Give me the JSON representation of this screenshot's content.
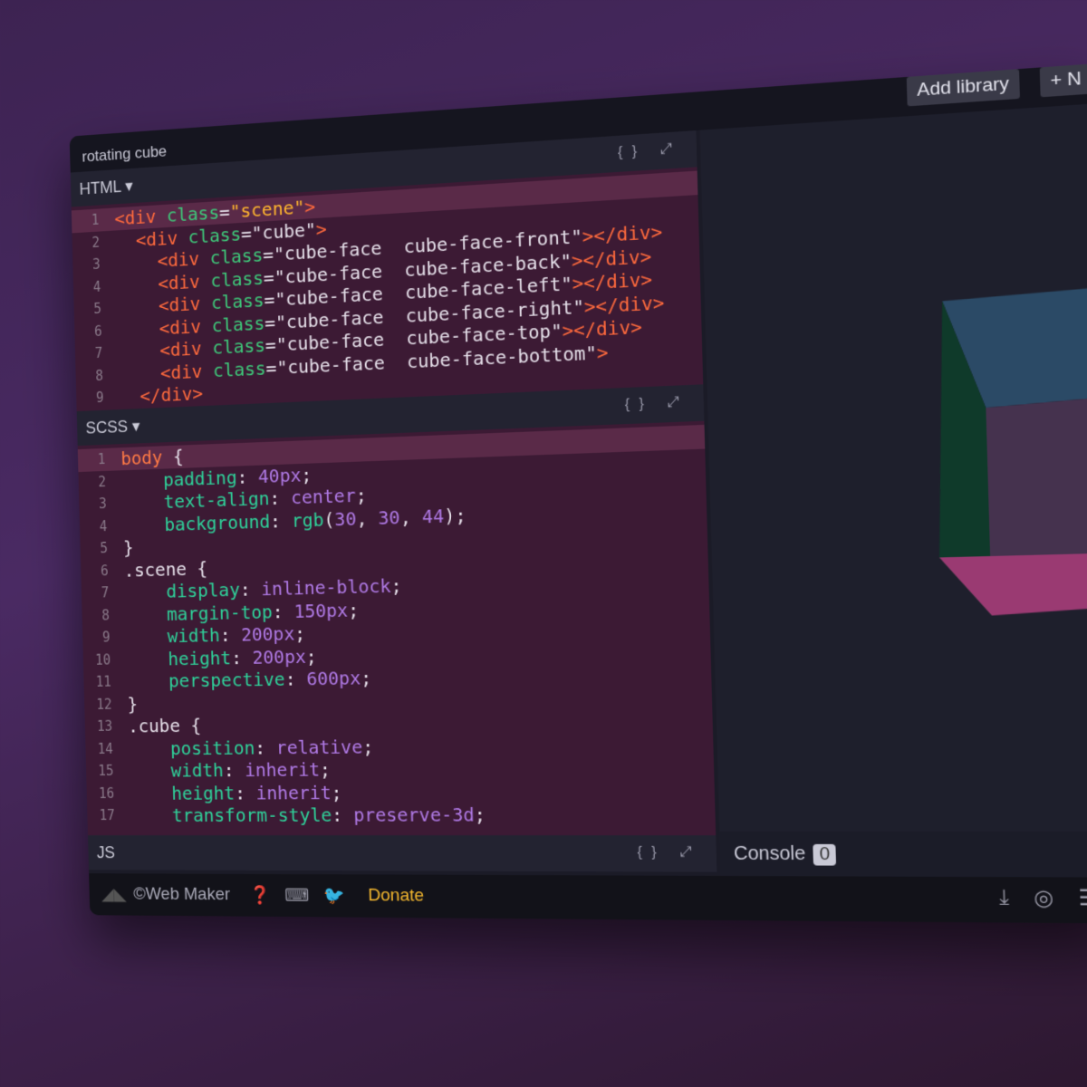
{
  "window": {
    "title": "rotating cube",
    "add_library": "Add library",
    "new": "+ N"
  },
  "html_pane": {
    "label": "HTML ▾",
    "icons": "{} ⤢",
    "lines": [
      [
        [
          "<div ",
          "tag"
        ],
        [
          "class",
          "attr"
        ],
        [
          "=",
          "plain"
        ],
        [
          "\"scene\"",
          "str"
        ],
        [
          ">",
          "tag"
        ]
      ],
      [
        [
          "  <div ",
          "tag"
        ],
        [
          "class",
          "attr"
        ],
        [
          "=\"cube\"",
          "plain"
        ],
        [
          ">",
          "tag"
        ]
      ],
      [
        [
          "    <div ",
          "tag"
        ],
        [
          "class",
          "attr"
        ],
        [
          "=\"cube-face  cube-face-front\"",
          "plain"
        ],
        [
          "></div>",
          "tag"
        ]
      ],
      [
        [
          "    <div ",
          "tag"
        ],
        [
          "class",
          "attr"
        ],
        [
          "=\"cube-face  cube-face-back\"",
          "plain"
        ],
        [
          "></div>",
          "tag"
        ]
      ],
      [
        [
          "    <div ",
          "tag"
        ],
        [
          "class",
          "attr"
        ],
        [
          "=\"cube-face  cube-face-left\"",
          "plain"
        ],
        [
          "></div>",
          "tag"
        ]
      ],
      [
        [
          "    <div ",
          "tag"
        ],
        [
          "class",
          "attr"
        ],
        [
          "=\"cube-face  cube-face-right\"",
          "plain"
        ],
        [
          "></div>",
          "tag"
        ]
      ],
      [
        [
          "    <div ",
          "tag"
        ],
        [
          "class",
          "attr"
        ],
        [
          "=\"cube-face  cube-face-top\"",
          "plain"
        ],
        [
          "></div>",
          "tag"
        ]
      ],
      [
        [
          "    <div ",
          "tag"
        ],
        [
          "class",
          "attr"
        ],
        [
          "=\"cube-face  cube-face-bottom\"",
          "plain"
        ],
        [
          ">",
          "tag"
        ]
      ],
      [
        [
          "  </div>",
          "tag"
        ]
      ]
    ]
  },
  "scss_pane": {
    "label": "SCSS ▾",
    "icons": "{} ⤢",
    "lines": [
      [
        [
          "body ",
          "sel"
        ],
        [
          "{",
          "plain"
        ]
      ],
      [
        [
          "    padding",
          "prop"
        ],
        [
          ": ",
          "plain"
        ],
        [
          "40px",
          "val"
        ],
        [
          ";",
          "plain"
        ]
      ],
      [
        [
          "    text-align",
          "prop"
        ],
        [
          ": ",
          "plain"
        ],
        [
          "center",
          "val"
        ],
        [
          ";",
          "plain"
        ]
      ],
      [
        [
          "    background",
          "prop"
        ],
        [
          ": ",
          "plain"
        ],
        [
          "rgb",
          "prop"
        ],
        [
          "(",
          "plain"
        ],
        [
          "30",
          "val"
        ],
        [
          ", ",
          "plain"
        ],
        [
          "30",
          "val"
        ],
        [
          ", ",
          "plain"
        ],
        [
          "44",
          "val"
        ],
        [
          ");",
          "plain"
        ]
      ],
      [
        [
          "}",
          "plain"
        ]
      ],
      [
        [
          ".scene {",
          "plain"
        ]
      ],
      [
        [
          "    display",
          "prop"
        ],
        [
          ": ",
          "plain"
        ],
        [
          "inline-block",
          "val"
        ],
        [
          ";",
          "plain"
        ]
      ],
      [
        [
          "    margin-top",
          "prop"
        ],
        [
          ": ",
          "plain"
        ],
        [
          "150px",
          "val"
        ],
        [
          ";",
          "plain"
        ]
      ],
      [
        [
          "    width",
          "prop"
        ],
        [
          ": ",
          "plain"
        ],
        [
          "200px",
          "val"
        ],
        [
          ";",
          "plain"
        ]
      ],
      [
        [
          "    height",
          "prop"
        ],
        [
          ": ",
          "plain"
        ],
        [
          "200px",
          "val"
        ],
        [
          ";",
          "plain"
        ]
      ],
      [
        [
          "    perspective",
          "prop"
        ],
        [
          ": ",
          "plain"
        ],
        [
          "600px",
          "val"
        ],
        [
          ";",
          "plain"
        ]
      ],
      [
        [
          "}",
          "plain"
        ]
      ],
      [
        [
          ".cube {",
          "plain"
        ]
      ],
      [
        [
          "    position",
          "prop"
        ],
        [
          ": ",
          "plain"
        ],
        [
          "relative",
          "val"
        ],
        [
          ";",
          "plain"
        ]
      ],
      [
        [
          "    width",
          "prop"
        ],
        [
          ": ",
          "plain"
        ],
        [
          "inherit",
          "val"
        ],
        [
          ";",
          "plain"
        ]
      ],
      [
        [
          "    height",
          "prop"
        ],
        [
          ": ",
          "plain"
        ],
        [
          "inherit",
          "val"
        ],
        [
          ";",
          "plain"
        ]
      ],
      [
        [
          "    transform-style",
          "prop"
        ],
        [
          ": ",
          "plain"
        ],
        [
          "preserve-3d",
          "val"
        ],
        [
          ";",
          "plain"
        ]
      ]
    ]
  },
  "js_pane": {
    "label": "JS",
    "icons": "{} ⤢"
  },
  "console": {
    "label": "Console",
    "count": "0"
  },
  "footer": {
    "brand": "©Web Maker",
    "donate": "Donate",
    "icons": [
      "help-icon",
      "keyboard-icon",
      "twitter-icon",
      "download-icon",
      "codepen-icon",
      "layout-icon"
    ]
  },
  "colors": {
    "accent": "#f5b82e",
    "code_bg": "#3c1a34"
  }
}
